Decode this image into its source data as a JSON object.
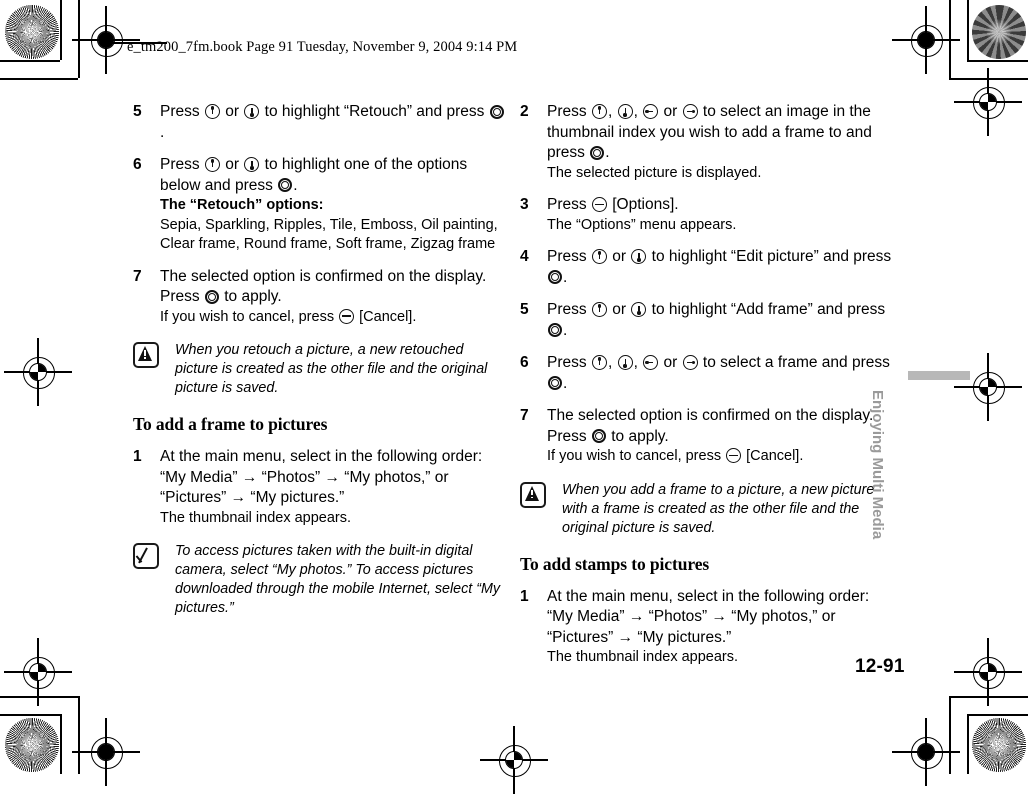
{
  "header": {
    "book_info": "e_tm200_7fm.book  Page 91  Tuesday, November 9, 2004  9:14 PM"
  },
  "side_tab": {
    "label": "Enjoying Multi Media"
  },
  "page_number": "12-91",
  "icons": {
    "up": "nav-up-key-icon",
    "down": "nav-down-key-icon",
    "left": "nav-left-key-icon",
    "right": "nav-right-key-icon",
    "center": "center-select-key-icon",
    "softkey": "soft-key-icon",
    "warning": "warning-note-icon",
    "tip": "tip-check-note-icon"
  },
  "left_column": {
    "steps": [
      {
        "num": "5",
        "text_a": "Press ",
        "text_b": " or ",
        "text_c": " to highlight “Retouch” and press ",
        "text_d": "."
      },
      {
        "num": "6",
        "text_a": "Press ",
        "text_b": " or ",
        "text_c": " to highlight one of the options below and press ",
        "text_d": ".",
        "options_title": "The “Retouch” options:",
        "options_list": "Sepia, Sparkling, Ripples, Tile, Emboss, Oil painting, Clear frame, Round frame, Soft frame, Zigzag frame"
      },
      {
        "num": "7",
        "line1": "The selected option is confirmed on the display.",
        "line2_a": "Press ",
        "line2_b": " to apply.",
        "line3_a": "If you wish to cancel, press ",
        "line3_b": " [Cancel]."
      }
    ],
    "warning_note": "When you retouch a picture, a new retouched picture is created as the other file and the original picture is saved.",
    "section_heading": "To add a frame to pictures",
    "frame_step1": {
      "num": "1",
      "line1": "At the main menu, select in the following order:",
      "line2": "“My Media” → “Photos” → “My photos,” or",
      "line3": "“Pictures” → “My pictures.”",
      "line4": "The thumbnail index appears."
    },
    "tip_note": "To access pictures taken with the built-in digital camera, select “My photos.” To access pictures downloaded through the mobile Internet, select “My pictures.”"
  },
  "right_column": {
    "steps": [
      {
        "num": "2",
        "text_a": "Press ",
        "sep1": ", ",
        "sep2": ", ",
        "text_b": " or ",
        "text_c": " to select an image in the thumbnail index you wish to add a frame to and press ",
        "text_d": ".",
        "result": "The selected picture is displayed."
      },
      {
        "num": "3",
        "text_a": "Press ",
        "text_b": " [Options].",
        "result": "The “Options” menu appears."
      },
      {
        "num": "4",
        "text_a": "Press ",
        "text_b": " or ",
        "text_c": " to highlight “Edit picture” and press ",
        "text_d": "."
      },
      {
        "num": "5",
        "text_a": "Press ",
        "text_b": " or ",
        "text_c": " to highlight “Add frame” and press ",
        "text_d": "."
      },
      {
        "num": "6",
        "text_a": "Press ",
        "sep1": ", ",
        "sep2": ", ",
        "text_b": " or ",
        "text_c": " to select a frame and press ",
        "text_d": "."
      },
      {
        "num": "7",
        "line1": "The selected option is confirmed on the display.",
        "line2_a": "Press ",
        "line2_b": " to apply.",
        "line3_a": "If you wish to cancel, press ",
        "line3_b": " [Cancel]."
      }
    ],
    "warning_note": "When you add a frame to a picture, a new picture with a frame is created as the other file and the original picture is saved.",
    "section_heading": "To add stamps to pictures",
    "stamp_step1": {
      "num": "1",
      "line1": "At the main menu, select in the following order:",
      "line2": "“My Media” → “Photos” → “My photos,” or",
      "line3": "“Pictures” → “My pictures.”",
      "line4": "The thumbnail index appears."
    }
  }
}
